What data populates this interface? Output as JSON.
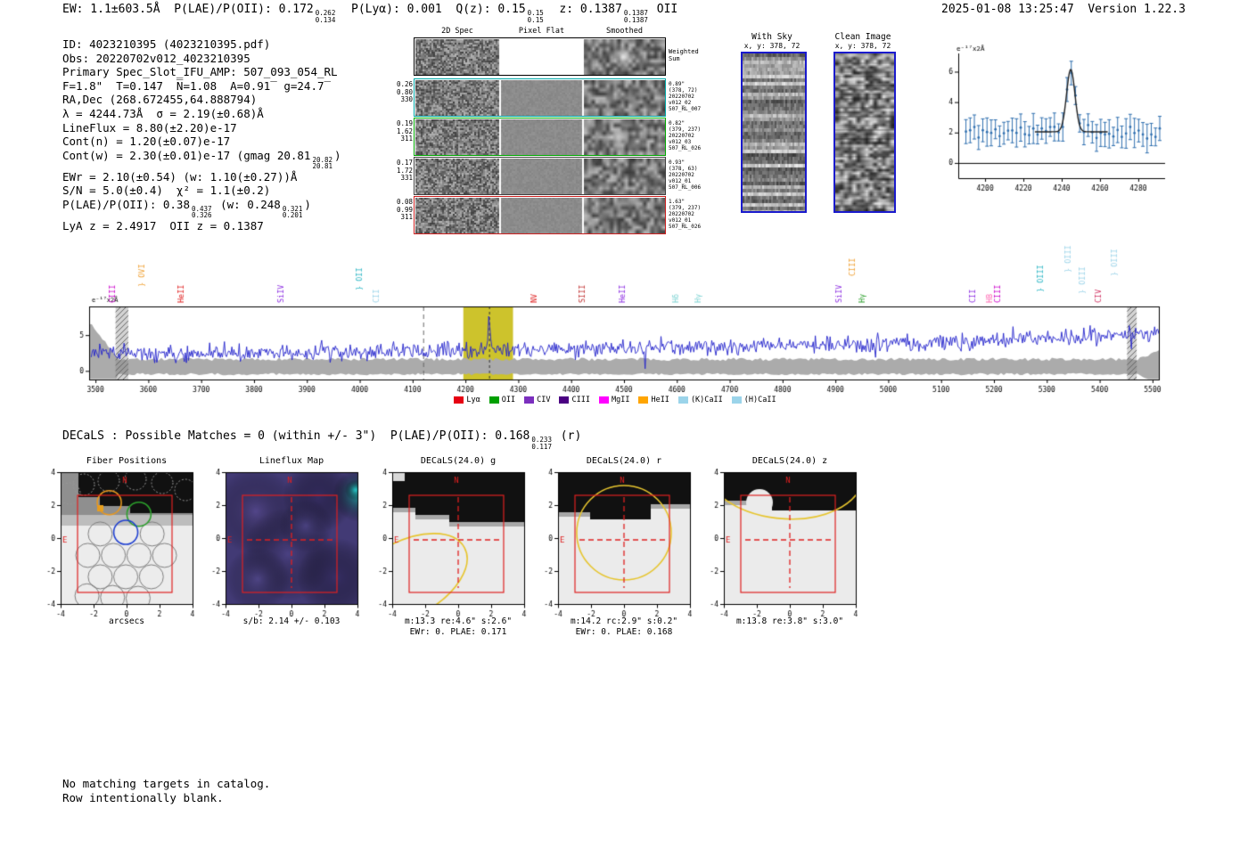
{
  "header": {
    "left_segments": [
      {
        "t": "EW: 1.1±603.5Å  P(LAE)/P(OII): 0.172"
      },
      {
        "u": "0.262",
        "d": "0.134"
      },
      {
        "t": "  P(Lyα): 0.001  Q(z): 0.15"
      },
      {
        "u": "0.15",
        "d": "0.15"
      },
      {
        "t": "  z: 0.1387"
      },
      {
        "u": "0.1387",
        "d": "0.1387"
      },
      {
        "t": " OII"
      }
    ],
    "right": "2025-01-08 13:25:47  Version 1.22.3"
  },
  "info": {
    "lines": [
      [
        {
          "t": "ID: 4023210395 (4023210395.pdf)"
        }
      ],
      [
        {
          "t": "Obs: 20220702v012_4023210395"
        }
      ],
      [
        {
          "t": "Primary Spec_Slot_IFU_AMP: 507_093_054_RL"
        }
      ],
      [
        {
          "t": "F=1.8\"  T=0.147  N̅=1.08  A=0.91̅  g=24.7̅"
        }
      ],
      [
        {
          "t": "RA,Dec (268.672455,64.888794)"
        }
      ],
      [
        {
          "t": "λ = 4244.73Å  σ = 2.19(±0.68)Å"
        }
      ],
      [
        {
          "t": "LineFlux = 8.80(±2.20)e-17"
        }
      ],
      [
        {
          "t": "Cont(n) = 1.20(±0.07)e-17"
        }
      ],
      [
        {
          "t": "Cont(w) = 2.30(±0.01)e-17 (gmag 20.81"
        },
        {
          "u": "20.82",
          "d": "20.81"
        },
        {
          "t": ")"
        }
      ],
      [
        {
          "t": "EWr = 2.10(±0.54) (w: 1.10(±0.27))Å"
        }
      ],
      [
        {
          "t": "S/N = 5.0(±0.4)  χ² = 1.1(±0.2)"
        }
      ],
      [
        {
          "t": "P(LAE)/P(OII): 0.38"
        },
        {
          "u": "0.437",
          "d": "0.326"
        },
        {
          "t": " (w: 0.248"
        },
        {
          "u": "0.321",
          "d": "0.201"
        },
        {
          "t": ")"
        }
      ],
      [
        {
          "t": "LyA z = 2.4917  OII z = 0.1387"
        }
      ]
    ]
  },
  "spec2d": {
    "col_headers": [
      "2D Spec",
      "Pixel Flat",
      "Smoothed"
    ],
    "rows": [
      {
        "left": [],
        "right": [
          "Weighted",
          "Sum"
        ],
        "border": "#000000"
      },
      {
        "left": [
          "0.26",
          "0.80",
          "330"
        ],
        "right": [
          "0.89\"",
          "(378, 72)",
          "20220702",
          "v012_02",
          "507_RL_007"
        ],
        "border": "#00a8a8"
      },
      {
        "left": [
          "0.19",
          "1.62",
          "311"
        ],
        "right": [
          "0.82\"",
          "(379, 237)",
          "20220702",
          "v012_03",
          "507_RL_026"
        ],
        "border": "#00a800"
      },
      {
        "left": [
          "0.17",
          "1.72",
          "331"
        ],
        "right": [
          "0.93\"",
          "(378, 63)",
          "20220702",
          "v012_01",
          "507_RL_006"
        ],
        "border": "#404040"
      },
      {
        "left": [
          "0.08",
          "0.99",
          "311"
        ],
        "right": [
          "1.63\"",
          "(379, 237)",
          "20220702",
          "v012_01",
          "507_RL_026"
        ],
        "border": "#cc2020"
      }
    ]
  },
  "cutouts": {
    "with_sky": {
      "title": "With Sky",
      "subtitle": "x, y: 378, 72"
    },
    "clean": {
      "title": "Clean Image",
      "subtitle": "x, y: 378, 72"
    }
  },
  "chart_data": [
    {
      "id": "linefit",
      "type": "scatter",
      "title": "Emission line fit cutout",
      "ylabel": "e⁻¹⁷x2Å",
      "xlim": [
        4186,
        4294
      ],
      "ylim": [
        -1.0,
        7.2
      ],
      "xticks": [
        4200,
        4220,
        4240,
        4260,
        4280
      ],
      "yticks": [
        0,
        2,
        4,
        6
      ],
      "continuum": 2.05,
      "point_err": 0.75,
      "gaussian": {
        "center": 4244.73,
        "sigma": 2.19,
        "amplitude": 4.1
      },
      "note": "blue errorbar spectrum points near flux 2 with Gaussian emission line peaking ~6.2 at 4244.73Å, black model fit, black zero line"
    },
    {
      "id": "spectrum",
      "type": "line",
      "title": "Full spectrum 3500-5500Å",
      "ylabel": "e⁻¹⁷x2Å",
      "xlim": [
        3488,
        5512
      ],
      "ylim": [
        -1.2,
        9.0
      ],
      "xticks": [
        3500,
        3600,
        3700,
        3800,
        3900,
        4000,
        4100,
        4200,
        4300,
        4400,
        4500,
        4600,
        4700,
        4800,
        4900,
        5000,
        5100,
        5200,
        5300,
        5400,
        5500
      ],
      "yticks": [
        0,
        5
      ],
      "profile": [
        [
          3500,
          2.6
        ],
        [
          3600,
          2.45
        ],
        [
          3700,
          2.5
        ],
        [
          3800,
          2.55
        ],
        [
          3900,
          2.7
        ],
        [
          4000,
          2.8
        ],
        [
          4100,
          2.75
        ],
        [
          4200,
          2.9
        ],
        [
          4300,
          3.0
        ],
        [
          4400,
          3.1
        ],
        [
          4500,
          3.15
        ],
        [
          4600,
          3.3
        ],
        [
          4700,
          3.45
        ],
        [
          4800,
          3.55
        ],
        [
          4900,
          3.7
        ],
        [
          5000,
          3.85
        ],
        [
          5100,
          4.0
        ],
        [
          5200,
          4.25
        ],
        [
          5300,
          4.6
        ],
        [
          5400,
          4.9
        ],
        [
          5500,
          5.3
        ],
        [
          5512,
          5.4
        ]
      ],
      "noise_amp": 1.15,
      "gaussian": {
        "center": 4244.73,
        "sigma": 2.19,
        "amplitude": 4.3
      },
      "highlight_band": [
        4196,
        4290
      ],
      "hatched_bands": [
        [
          3538,
          3562
        ],
        [
          5452,
          5470
        ]
      ],
      "dashed_lines": [
        4120,
        4244.7
      ],
      "error_band": {
        "center": 0.55,
        "half_width": 0.85
      },
      "line_labels": [
        {
          "wl": 3532,
          "label": "CIII",
          "color": "#cc00cc"
        },
        {
          "wl": 3588,
          "label": "} OVI",
          "color": "#f0a030",
          "dy": -18
        },
        {
          "wl": 3663,
          "label": "HeII",
          "color": "#e02020"
        },
        {
          "wl": 3852,
          "label": "SiIV",
          "color": "#8b2be2"
        },
        {
          "wl": 4000,
          "label": "} OII",
          "color": "#29b6c5",
          "dy": -14
        },
        {
          "wl": 4032,
          "label": "CII",
          "color": "#9bd4ea"
        },
        {
          "wl": 4330,
          "label": "NV",
          "color": "#e02020"
        },
        {
          "wl": 4422,
          "label": "SIII",
          "color": "#c03030"
        },
        {
          "wl": 4498,
          "label": "HeII",
          "color": "#8b2be2"
        },
        {
          "wl": 4598,
          "label": "Hδ",
          "color": "#7fd4d4"
        },
        {
          "wl": 4640,
          "label": "Hγ",
          "color": "#7fd4d4"
        },
        {
          "wl": 4908,
          "label": "SiIV",
          "color": "#8b2be2"
        },
        {
          "wl": 4933,
          "label": "CIII",
          "color": "#f0a030",
          "dy": -30
        },
        {
          "wl": 4952,
          "label": "Hγ",
          "color": "#2ca02c"
        },
        {
          "wl": 5160,
          "label": "CII",
          "color": "#8b2be2"
        },
        {
          "wl": 5192,
          "label": "HB",
          "color": "#ff69b4"
        },
        {
          "wl": 5208,
          "label": "CIII",
          "color": "#cc00cc"
        },
        {
          "wl": 5288,
          "label": "} OIII",
          "color": "#29b6c5",
          "dy": -12
        },
        {
          "wl": 5340,
          "label": "} OIII",
          "color": "#9bd4ea",
          "dy": -34
        },
        {
          "wl": 5368,
          "label": "} OIII",
          "color": "#9bd4ea",
          "dy": -10
        },
        {
          "wl": 5398,
          "label": "CIV",
          "color": "#d03060"
        },
        {
          "wl": 5428,
          "label": "} OIII",
          "color": "#9bd4ea",
          "dy": -30
        }
      ],
      "legend": [
        {
          "label": "Lyα",
          "color": "#e60012"
        },
        {
          "label": "OII",
          "color": "#00a000"
        },
        {
          "label": "CIV",
          "color": "#7b2fbe"
        },
        {
          "label": "CIII",
          "color": "#4b0082"
        },
        {
          "label": "MgII",
          "color": "#ff00ff"
        },
        {
          "label": "HeII",
          "color": "#ffa500"
        },
        {
          "label": "(K)CaII",
          "color": "#9bd4ea"
        },
        {
          "label": "(H)CaII",
          "color": "#9bd4ea"
        }
      ]
    }
  ],
  "decals": {
    "matches_segments": [
      {
        "t": "DECaLS : Possible Matches = 0 (within +/- 3\")  P(LAE)/P(OII): 0.168"
      },
      {
        "u": "0.233",
        "d": "0.117"
      },
      {
        "t": " (r)"
      }
    ]
  },
  "panels_common": {
    "ticks": [
      -4,
      -2,
      0,
      2,
      4
    ]
  },
  "panels": [
    {
      "id": "fiber",
      "title": "Fiber Positions",
      "captions": [
        "arcsecs"
      ]
    },
    {
      "id": "lineflux",
      "title": "Lineflux Map",
      "captions": [
        "s/b: 2.14 +/- 0.103"
      ]
    },
    {
      "id": "decals_g",
      "title": "DECaLS(24.0) g",
      "captions": [
        "m:13.3 re:4.6\" s:2.6\"",
        "EWr: 0. PLAE: 0.171"
      ]
    },
    {
      "id": "decals_r",
      "title": "DECaLS(24.0) r",
      "captions": [
        "m:14.2 rc:2.9\" s:0.2\"",
        "EWr: 0. PLAE: 0.168"
      ]
    },
    {
      "id": "decals_z",
      "title": "DECaLS(24.0) z",
      "captions": [
        "m:13.8 re:3.8\" s:3.0\""
      ]
    }
  ],
  "compass": {
    "north": "N",
    "east": "E"
  },
  "footer": {
    "lines": [
      "No matching targets in catalog.",
      "Row intentionally blank."
    ]
  }
}
